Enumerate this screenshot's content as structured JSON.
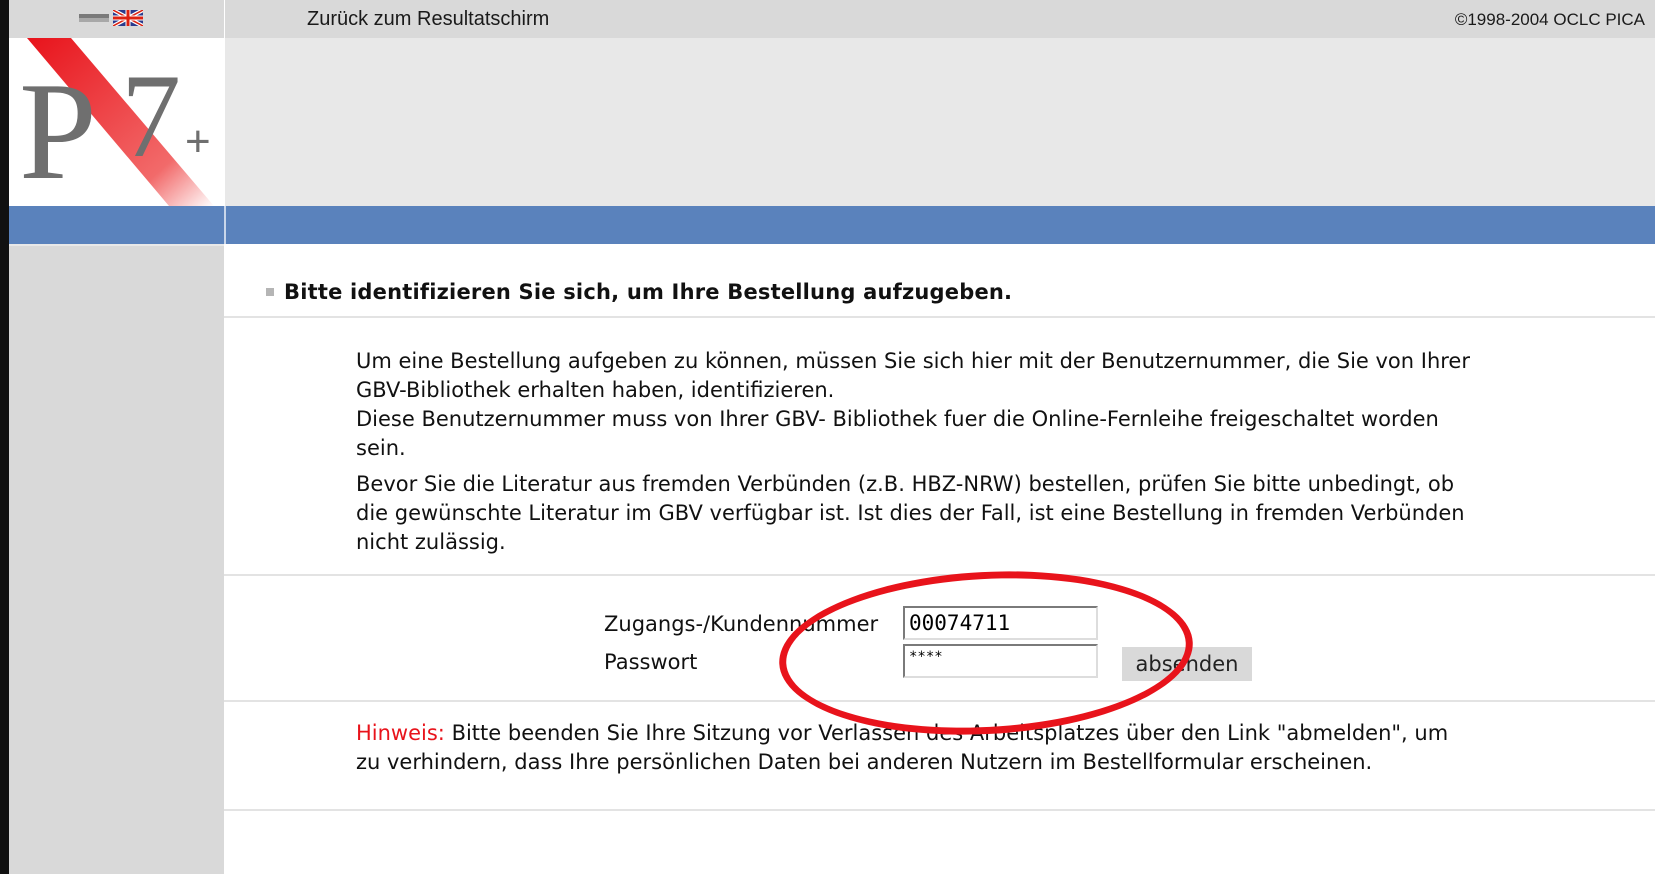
{
  "topbar": {
    "back_link": "Zurück zum Resultatschirm",
    "copyright": "©1998-2004 OCLC PICA"
  },
  "logo": {
    "text": "P7+"
  },
  "heading": "Bitte identifizieren Sie sich, um Ihre Bestellung aufzugeben.",
  "intro": {
    "line1": "Um eine Bestellung aufgeben zu können, müssen Sie sich hier mit der Benutzernummer, die Sie von Ihrer",
    "line2": "GBV-Bibliothek erhalten haben, identifizieren.",
    "line3": "Diese Benutzernummer muss von Ihrer GBV- Bibliothek fuer die Online-Fernleihe freigeschaltet worden",
    "line4": "sein."
  },
  "warning": {
    "line1": "Bevor Sie die Literatur aus fremden Verbünden (z.B. HBZ-NRW) bestellen, prüfen Sie bitte unbedingt, ob",
    "line2": "die gewünschte Literatur im GBV verfügbar ist. Ist dies der Fall, ist eine Bestellung in fremden Verbünden",
    "line3": "nicht zulässig."
  },
  "form": {
    "user_label": "Zugangs-/Kundennummer",
    "user_value": "00074711",
    "password_label": "Passwort",
    "password_value": "****",
    "submit_label": "absenden"
  },
  "hint": {
    "label": "Hinweis:",
    "line1": " Bitte beenden Sie Ihre Sitzung vor Verlassen des Arbeitsplatzes über den Link \"abmelden\", um",
    "line2": "zu verhindern, dass Ihre persönlichen Daten bei anderen Nutzern im Bestellformular erscheinen."
  },
  "colors": {
    "accent_blue": "#5a82bc",
    "highlight_red": "#e8131b",
    "panel_gray": "#d9d9d9"
  }
}
